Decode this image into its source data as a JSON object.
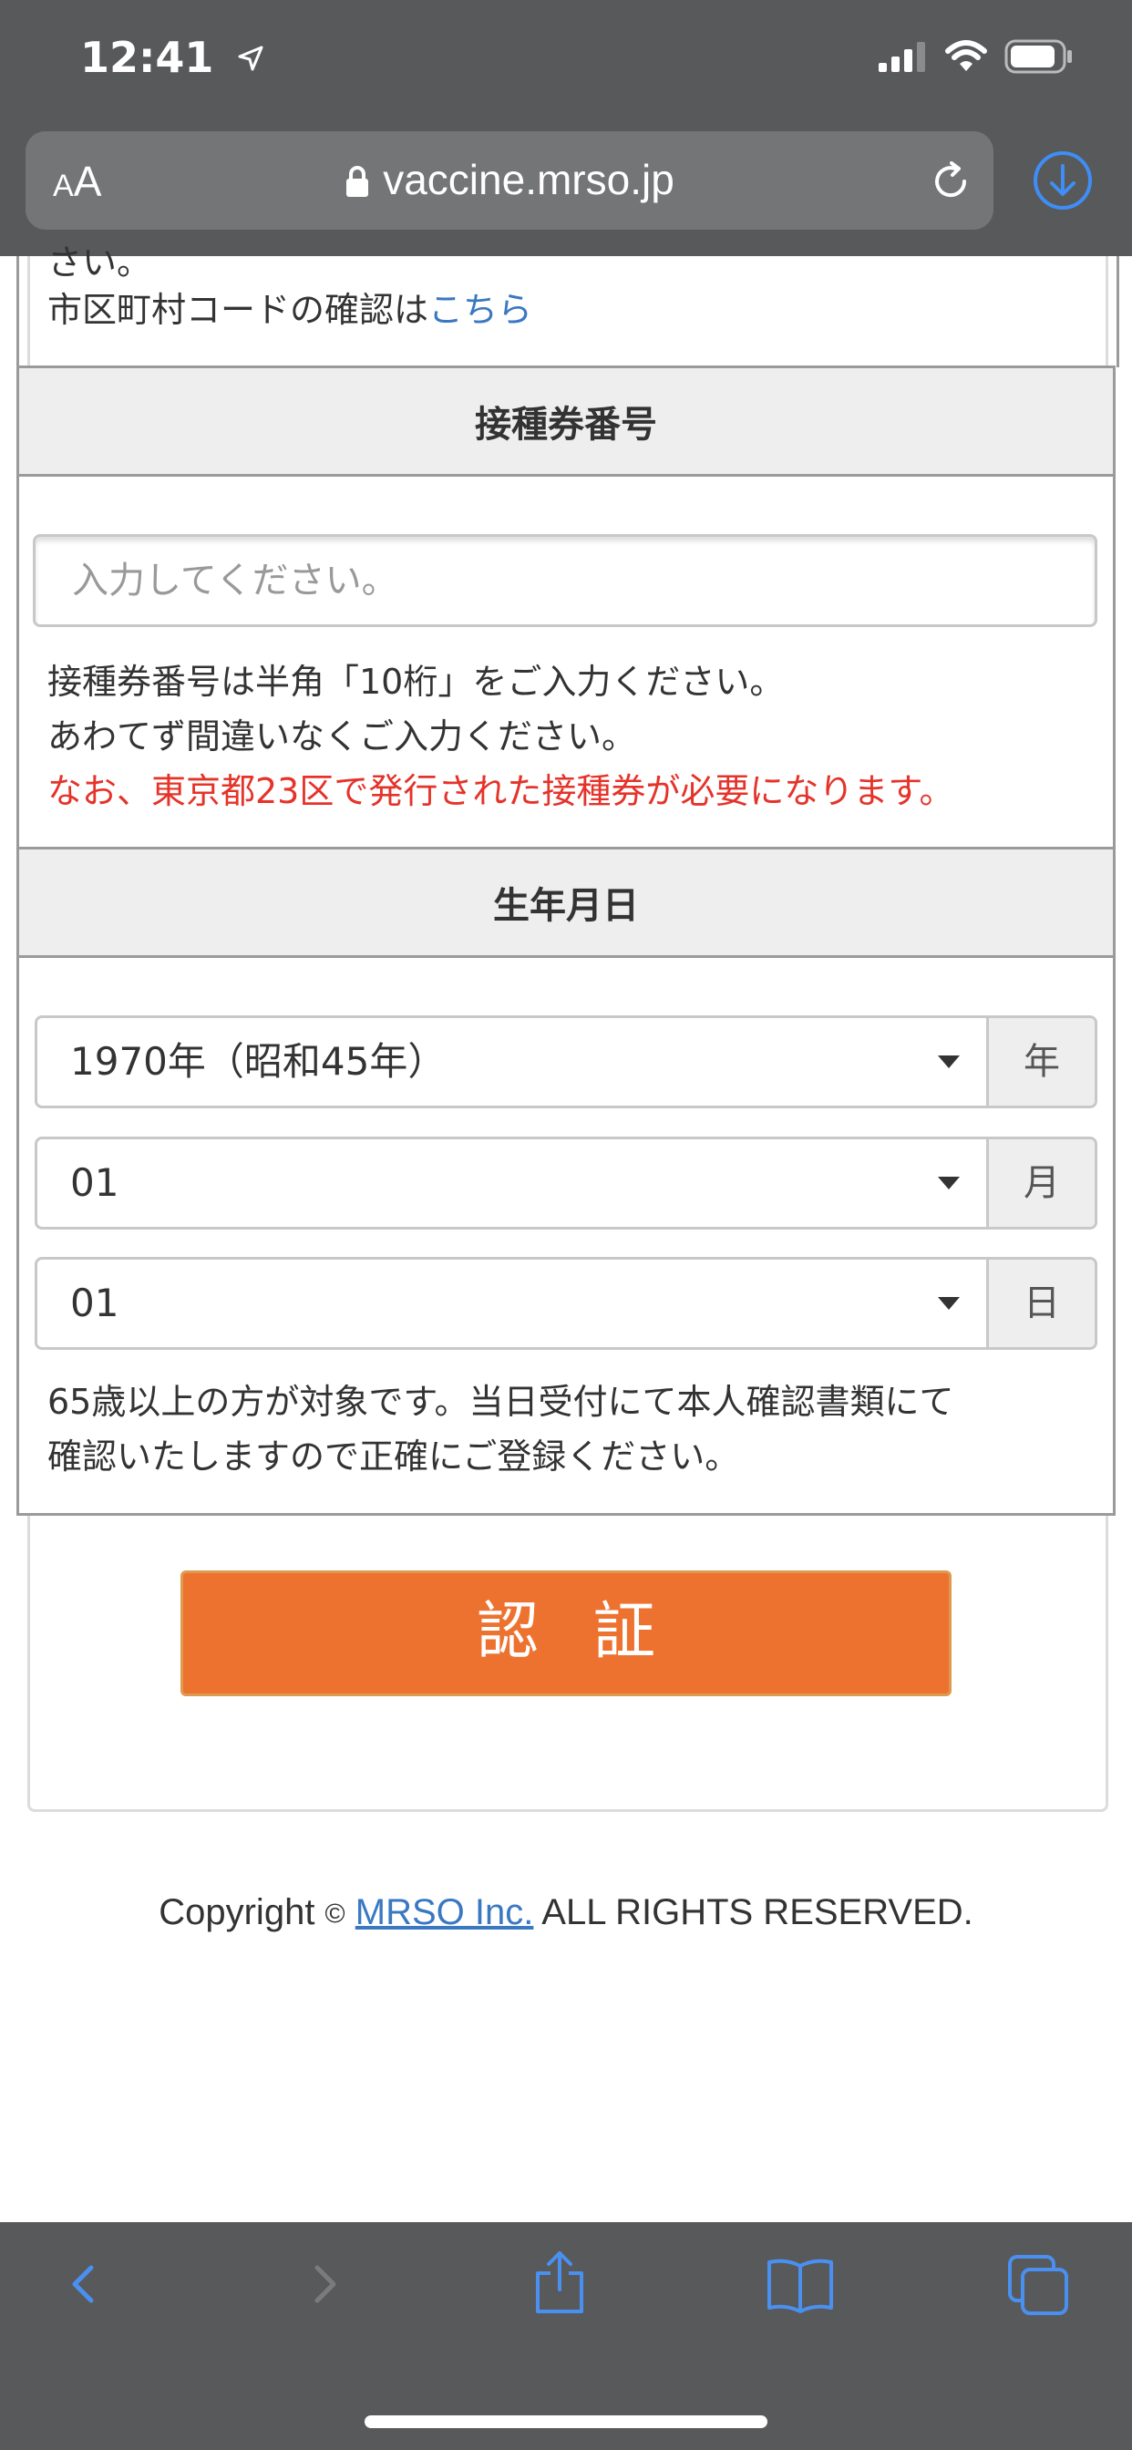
{
  "status_bar": {
    "time": "12:41"
  },
  "browser": {
    "text_size_label_small": "A",
    "text_size_label_big": "A",
    "url": "vaccine.mrso.jp"
  },
  "page": {
    "top_partial_text": "さい。",
    "municode_text": "市区町村コードの確認は",
    "municode_link": "こちら",
    "ticket_section": {
      "heading": "接種券番号",
      "input_placeholder": "入力してください。",
      "help_line1": "接種券番号は半角「10桁」をご入力ください。",
      "help_line2": "あわてず間違いなくご入力ください。",
      "help_line3": "なお、東京都23区で発行された接種券が必要になります。"
    },
    "birth_section": {
      "heading": "生年月日",
      "year_value": "1970年（昭和45年）",
      "year_unit": "年",
      "month_value": "01",
      "month_unit": "月",
      "day_value": "01",
      "day_unit": "日",
      "note_line1": "65歳以上の方が対象です。当日受付にて本人確認書類にて",
      "note_line2": "確認いたしますので正確にご登録ください。"
    },
    "submit_label": "認証",
    "footer": {
      "prefix": "Copyright ",
      "symbol": "©",
      "company_link": "MRSO Inc.",
      "suffix": " ALL RIGHTS RESERVED."
    }
  },
  "colors": {
    "chrome": "#58595b",
    "accent_blue": "#3a78c2",
    "button_orange": "#ee722f",
    "warning_red": "#e5332a"
  },
  "icons": [
    "location-arrow-icon",
    "signal-icon",
    "wifi-icon",
    "battery-icon",
    "lock-icon",
    "reload-icon",
    "download-icon",
    "back-icon",
    "forward-icon",
    "share-icon",
    "bookmarks-icon",
    "tabs-icon"
  ]
}
